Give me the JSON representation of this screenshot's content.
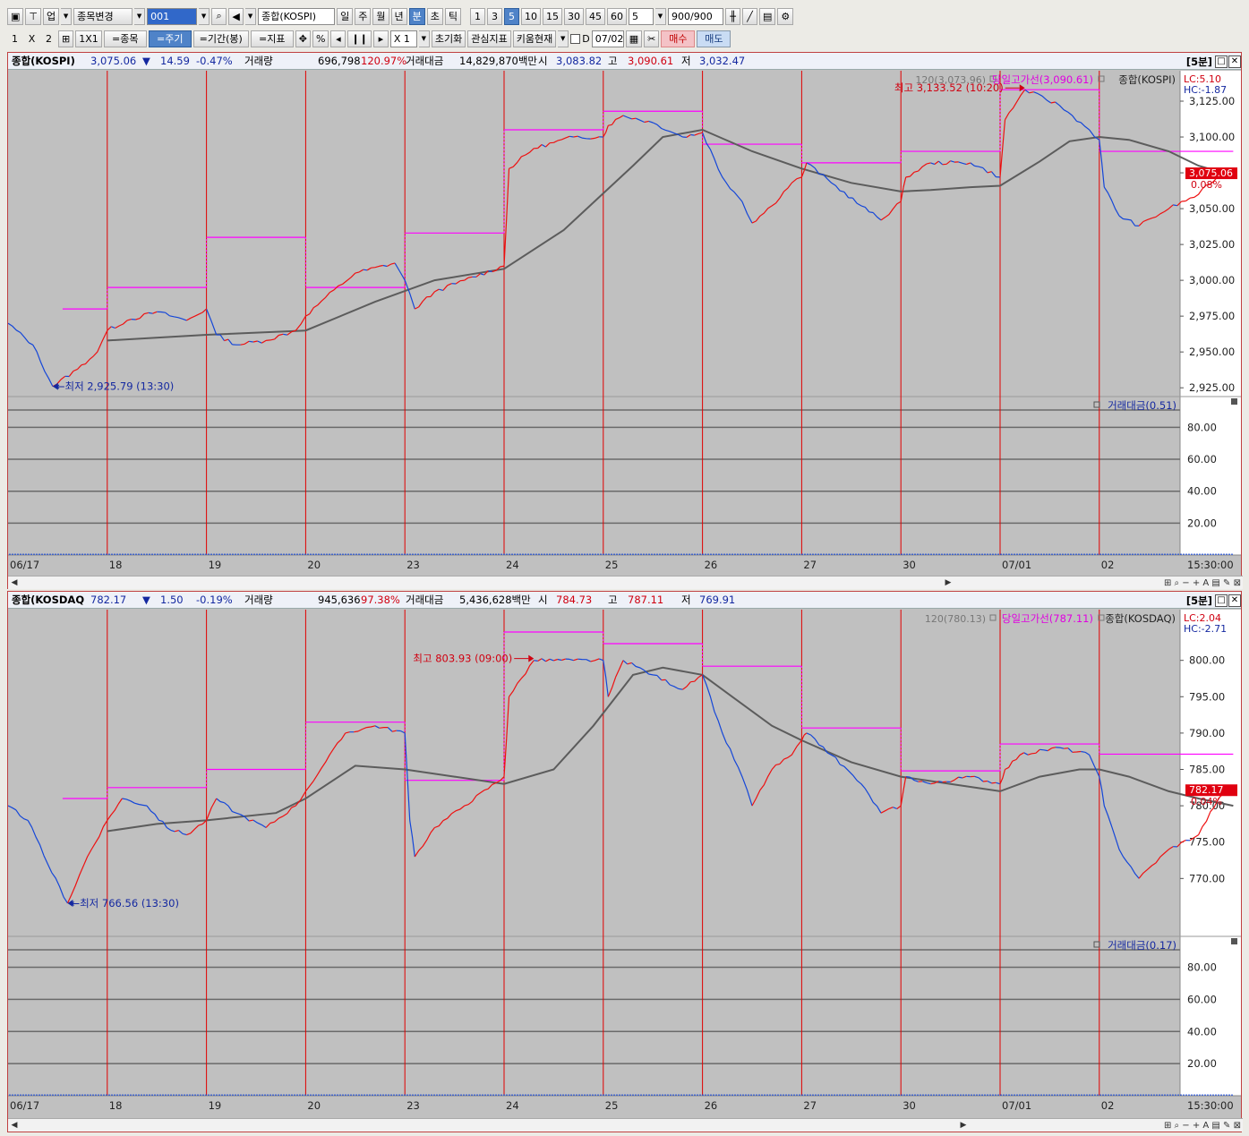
{
  "toolbar1": {
    "up_label": "업",
    "stock_change": "종목변경",
    "code": "001",
    "market_name": "종합(KOSPI)",
    "period_buttons": [
      "일",
      "주",
      "월",
      "년",
      "분",
      "초",
      "틱"
    ],
    "minute_buttons": [
      "1",
      "3",
      "5",
      "10",
      "15",
      "30",
      "45",
      "60"
    ],
    "interval_value": "5",
    "count_value": "900",
    "count_total": "/900"
  },
  "toolbar2": {
    "layout_1": "1",
    "layout_x": "X",
    "layout_2": "2",
    "layout_1x1": "1X1",
    "item_btn": "=종목",
    "cycle_btn": "=주기",
    "period_btn": "=기간(봉)",
    "indicator_btn": "=지표",
    "pct": "%",
    "mult": "X 1",
    "reset": "초기화",
    "watch": "관심지표",
    "kiwoom": "키움현재",
    "d_label": "D",
    "date": "07/02",
    "buy": "매수",
    "sell": "매도"
  },
  "kospi": {
    "name": "종합(KOSPI)",
    "price": "3,075.06",
    "arrow": "▼",
    "change": "14.59",
    "change_pct": "-0.47%",
    "vol_label": "거래량",
    "volume": "696,798",
    "vol_pct": "120.97%",
    "amount_label": "거래대금",
    "amount": "14,829,870백만",
    "open_label": "시",
    "open": "3,083.82",
    "high_label": "고",
    "high": "3,090.61",
    "low_label": "저",
    "low": "3,032.47",
    "period": "[5분]",
    "legend_ma": "120(3,073.96)",
    "legend_high": "당일고가선(3,090.61)",
    "legend_name": "종합(KOSPI)",
    "lc": "LC:5.10",
    "hc": "HC:-1.87",
    "max_label": "최고 3,133.52 (10:20)",
    "min_label": "←최저 2,925.79 (13:30)",
    "price_tag": "3,075.06",
    "price_pct": "0.08%",
    "sub_legend": "거래대금(0.51)"
  },
  "kosdaq": {
    "name": "종합(KOSDAQ",
    "price": "782.17",
    "arrow": "▼",
    "change": "1.50",
    "change_pct": "-0.19%",
    "vol_label": "거래량",
    "volume": "945,636",
    "vol_pct": "97.38%",
    "amount_label": "거래대금",
    "amount": "5,436,628백만",
    "open_label": "시",
    "open": "784.73",
    "high_label": "고",
    "high": "787.11",
    "low_label": "저",
    "low": "769.91",
    "period": "[5분]",
    "legend_ma": "120(780.13)",
    "legend_high": "당일고가선(787.11)",
    "legend_name": "종합(KOSDAQ)",
    "lc": "LC:2.04",
    "hc": "HC:-2.71",
    "max_label": "최고 803.93 (09:00)",
    "min_label": "←최저 766.56 (13:30)",
    "price_tag": "782.17",
    "price_pct": "0.04%",
    "sub_legend": "거래대금(0.17)"
  },
  "chart_data": [
    {
      "type": "line",
      "title": "종합(KOSPI) 5분",
      "x_labels": [
        "06/17",
        "18",
        "19",
        "20",
        "23",
        "24",
        "25",
        "26",
        "27",
        "30",
        "07/01",
        "02"
      ],
      "time_label": "15:30:00",
      "y_ticks": [
        "3,125.00",
        "3,100.00",
        "3,075.00",
        "3,050.00",
        "3,025.00",
        "3,000.00",
        "2,975.00",
        "2,950.00",
        "2,925.00"
      ],
      "ylim": [
        2912,
        3140
      ],
      "series": [
        {
          "values": [
            [
              0,
              2970
            ],
            [
              0.25,
              2955
            ],
            [
              0.45,
              2926
            ],
            [
              0.7,
              2938
            ],
            [
              0.9,
              2950
            ],
            [
              1,
              2965
            ],
            [
              1.2,
              2972
            ],
            [
              1.5,
              2978
            ],
            [
              1.8,
              2972
            ],
            [
              2,
              2980
            ],
            [
              2.1,
              2962
            ],
            [
              2.3,
              2955
            ],
            [
              2.6,
              2958
            ],
            [
              2.9,
              2965
            ],
            [
              3,
              2975
            ],
            [
              3.2,
              2988
            ],
            [
              3.5,
              3005
            ],
            [
              3.9,
              3012
            ],
            [
              4,
              3000
            ],
            [
              4.1,
              2980
            ],
            [
              4.3,
              2992
            ],
            [
              4.6,
              3000
            ],
            [
              5,
              3010
            ],
            [
              5.05,
              3078
            ],
            [
              5.3,
              3092
            ],
            [
              5.7,
              3100
            ],
            [
              6,
              3100
            ],
            [
              6.05,
              3108
            ],
            [
              6.2,
              3115
            ],
            [
              6.5,
              3110
            ],
            [
              6.8,
              3100
            ],
            [
              7,
              3103
            ],
            [
              7.2,
              3072
            ],
            [
              7.4,
              3055
            ],
            [
              7.5,
              3040
            ],
            [
              7.7,
              3052
            ],
            [
              7.9,
              3068
            ],
            [
              8,
              3072
            ],
            [
              8.05,
              3082
            ],
            [
              8.3,
              3068
            ],
            [
              8.6,
              3052
            ],
            [
              8.8,
              3042
            ],
            [
              9,
              3055
            ],
            [
              9.05,
              3072
            ],
            [
              9.3,
              3082
            ],
            [
              9.7,
              3082
            ],
            [
              10,
              3072
            ],
            [
              10.05,
              3112
            ],
            [
              10.25,
              3133
            ],
            [
              10.6,
              3122
            ],
            [
              10.9,
              3105
            ],
            [
              11,
              3098
            ],
            [
              11.05,
              3065
            ],
            [
              11.2,
              3045
            ],
            [
              11.4,
              3038
            ],
            [
              11.7,
              3050
            ],
            [
              12,
              3060
            ],
            [
              12.2,
              3073
            ],
            [
              12.35,
              3075
            ]
          ]
        },
        {
          "name": "120",
          "values": [
            [
              1,
              2958
            ],
            [
              2,
              2962
            ],
            [
              3,
              2965
            ],
            [
              3.7,
              2985
            ],
            [
              4.3,
              3000
            ],
            [
              5,
              3008
            ],
            [
              5.6,
              3035
            ],
            [
              6.3,
              3080
            ],
            [
              6.6,
              3100
            ],
            [
              7,
              3105
            ],
            [
              7.5,
              3090
            ],
            [
              8,
              3078
            ],
            [
              8.5,
              3068
            ],
            [
              9,
              3062
            ],
            [
              9.3,
              3063
            ],
            [
              9.7,
              3065
            ],
            [
              10,
              3066
            ],
            [
              10.4,
              3083
            ],
            [
              10.7,
              3097
            ],
            [
              11,
              3100
            ],
            [
              11.3,
              3098
            ],
            [
              11.7,
              3090
            ],
            [
              12,
              3080
            ],
            [
              12.35,
              3073
            ]
          ]
        },
        {
          "name": "당일고가선",
          "steps": [
            [
              0.55,
              1,
              2980
            ],
            [
              1,
              2,
              2995
            ],
            [
              2,
              3,
              3030
            ],
            [
              3,
              4,
              2995
            ],
            [
              4,
              5,
              3033
            ],
            [
              5,
              6,
              3105
            ],
            [
              6,
              7,
              3118
            ],
            [
              7,
              8,
              3095
            ],
            [
              8,
              9,
              3082
            ],
            [
              9,
              10,
              3090
            ],
            [
              10,
              11,
              3133
            ],
            [
              11,
              12.35,
              3090
            ]
          ]
        }
      ],
      "sub": {
        "y_ticks": [
          "80.00",
          "60.00",
          "40.00",
          "20.00"
        ],
        "ylim": [
          0,
          92
        ]
      }
    },
    {
      "type": "line",
      "title": "종합(KOSDAQ) 5분",
      "x_labels": [
        "06/17",
        "18",
        "19",
        "20",
        "23",
        "24",
        "25",
        "26",
        "27",
        "30",
        "07/01",
        "02"
      ],
      "time_label": "15:30:00",
      "y_ticks": [
        "800.00",
        "795.00",
        "790.00",
        "785.00",
        "780.00",
        "775.00",
        "770.00"
      ],
      "ylim": [
        764.5,
        805.5
      ],
      "series": [
        {
          "values": [
            [
              0,
              780
            ],
            [
              0.2,
              778
            ],
            [
              0.4,
              772
            ],
            [
              0.6,
              766.6
            ],
            [
              0.8,
              773
            ],
            [
              1,
              778
            ],
            [
              1.15,
              781
            ],
            [
              1.4,
              780
            ],
            [
              1.6,
              777
            ],
            [
              1.8,
              776
            ],
            [
              2,
              778
            ],
            [
              2.1,
              781
            ],
            [
              2.3,
              779
            ],
            [
              2.6,
              777
            ],
            [
              2.9,
              780
            ],
            [
              3,
              782
            ],
            [
              3.2,
              786
            ],
            [
              3.4,
              790
            ],
            [
              3.7,
              791
            ],
            [
              4,
              790
            ],
            [
              4.05,
              778
            ],
            [
              4.1,
              773
            ],
            [
              4.3,
              777
            ],
            [
              4.6,
              780
            ],
            [
              5,
              784
            ],
            [
              5.05,
              795
            ],
            [
              5.3,
              800
            ],
            [
              5.7,
              800
            ],
            [
              6,
              800
            ],
            [
              6.05,
              795
            ],
            [
              6.2,
              800
            ],
            [
              6.5,
              798
            ],
            [
              6.8,
              796
            ],
            [
              7,
              798
            ],
            [
              7.2,
              790
            ],
            [
              7.4,
              784
            ],
            [
              7.5,
              780
            ],
            [
              7.7,
              785
            ],
            [
              7.9,
              787
            ],
            [
              8,
              789
            ],
            [
              8.05,
              790
            ],
            [
              8.3,
              787
            ],
            [
              8.6,
              783
            ],
            [
              8.8,
              779
            ],
            [
              9,
              780
            ],
            [
              9.05,
              784
            ],
            [
              9.3,
              783
            ],
            [
              9.7,
              784
            ],
            [
              10,
              783
            ],
            [
              10.05,
              785
            ],
            [
              10.2,
              787
            ],
            [
              10.6,
              788
            ],
            [
              10.9,
              787
            ],
            [
              11,
              784
            ],
            [
              11.05,
              780
            ],
            [
              11.2,
              774
            ],
            [
              11.4,
              770
            ],
            [
              11.7,
              774
            ],
            [
              12,
              776
            ],
            [
              12.2,
              781
            ],
            [
              12.35,
              782.2
            ]
          ]
        },
        {
          "name": "120",
          "values": [
            [
              1,
              776.5
            ],
            [
              1.5,
              777.5
            ],
            [
              2,
              778
            ],
            [
              2.7,
              779
            ],
            [
              3,
              781
            ],
            [
              3.5,
              785.5
            ],
            [
              4,
              785
            ],
            [
              4.5,
              784
            ],
            [
              5,
              783
            ],
            [
              5.5,
              785
            ],
            [
              5.9,
              791
            ],
            [
              6.3,
              798
            ],
            [
              6.6,
              799
            ],
            [
              7,
              798
            ],
            [
              7.3,
              795
            ],
            [
              7.7,
              791
            ],
            [
              8,
              789
            ],
            [
              8.5,
              786
            ],
            [
              9,
              784
            ],
            [
              9.5,
              783
            ],
            [
              10,
              782
            ],
            [
              10.4,
              784
            ],
            [
              10.8,
              785
            ],
            [
              11,
              785
            ],
            [
              11.3,
              784
            ],
            [
              11.7,
              782
            ],
            [
              12,
              781
            ],
            [
              12.35,
              780
            ]
          ]
        },
        {
          "name": "당일고가선",
          "steps": [
            [
              0.55,
              1,
              781
            ],
            [
              1,
              2,
              782.5
            ],
            [
              2,
              3,
              785
            ],
            [
              3,
              4,
              791.5
            ],
            [
              4,
              5,
              783.5
            ],
            [
              5,
              6,
              803.9
            ],
            [
              6,
              7,
              802.3
            ],
            [
              7,
              8,
              799.2
            ],
            [
              8,
              9,
              790.7
            ],
            [
              9,
              10,
              784.8
            ],
            [
              10,
              11,
              788.5
            ],
            [
              11,
              12.35,
              787.1
            ]
          ]
        }
      ],
      "sub": {
        "y_ticks": [
          "80.00",
          "60.00",
          "40.00",
          "20.00"
        ],
        "ylim": [
          0,
          92
        ]
      }
    }
  ]
}
